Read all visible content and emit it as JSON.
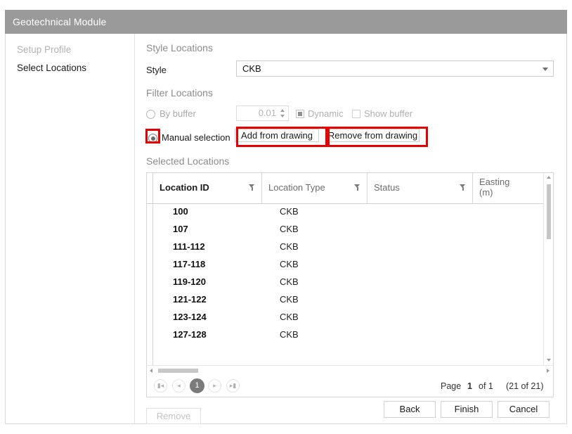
{
  "window": {
    "title": "Geotechnical Module"
  },
  "sidebar": {
    "items": [
      {
        "label": "Setup Profile",
        "state": "completed"
      },
      {
        "label": "Select Locations",
        "state": "active"
      }
    ]
  },
  "main": {
    "style_section": {
      "heading": "Style Locations",
      "style_label": "Style",
      "style_value": "CKB",
      "dropdown_icon": "chevron-down-icon"
    },
    "filter_section": {
      "heading": "Filter Locations",
      "by_buffer_label": "By buffer",
      "by_buffer_selected": false,
      "buffer_value": "0.01",
      "dynamic_label": "Dynamic",
      "dynamic_checked": true,
      "show_buffer_label": "Show buffer",
      "show_buffer_checked": false,
      "manual_label": "Manual selection",
      "manual_selected": true,
      "add_from_drawing_label": "Add from drawing",
      "remove_from_drawing_label": "Remove from drawing"
    },
    "selected_section": {
      "heading": "Selected Locations",
      "columns": [
        {
          "label": "Location ID",
          "filter_icon": "funnel-icon",
          "bold": true
        },
        {
          "label": "Location Type",
          "filter_icon": "funnel-icon",
          "bold": false
        },
        {
          "label": "Status",
          "filter_icon": "funnel-icon",
          "bold": false
        },
        {
          "label": "Easting\n(m)",
          "filter_icon": "",
          "bold": false
        }
      ],
      "rows": [
        {
          "location_id": "100",
          "location_type": "CKB",
          "status": "",
          "easting": ""
        },
        {
          "location_id": "107",
          "location_type": "CKB",
          "status": "",
          "easting": ""
        },
        {
          "location_id": "111-112",
          "location_type": "CKB",
          "status": "",
          "easting": ""
        },
        {
          "location_id": "117-118",
          "location_type": "CKB",
          "status": "",
          "easting": ""
        },
        {
          "location_id": "119-120",
          "location_type": "CKB",
          "status": "",
          "easting": ""
        },
        {
          "location_id": "121-122",
          "location_type": "CKB",
          "status": "",
          "easting": ""
        },
        {
          "location_id": "123-124",
          "location_type": "CKB",
          "status": "",
          "easting": ""
        },
        {
          "location_id": "127-128",
          "location_type": "CKB",
          "status": "",
          "easting": ""
        }
      ],
      "remove_label": "Remove"
    },
    "pager": {
      "first_icon": "⏮",
      "prev_icon": "◀",
      "current_page": "1",
      "next_icon": "▶",
      "last_icon": "⏭",
      "page_label": "Page",
      "page_number": "1",
      "of_label": "of 1",
      "count_label": "(21 of 21)"
    }
  },
  "footer": {
    "back_label": "Back",
    "finish_label": "Finish",
    "cancel_label": "Cancel"
  },
  "highlights": {
    "color": "#e60000",
    "targets": [
      "manual-selection-radio",
      "add-from-drawing-button",
      "remove-from-drawing-button"
    ]
  }
}
